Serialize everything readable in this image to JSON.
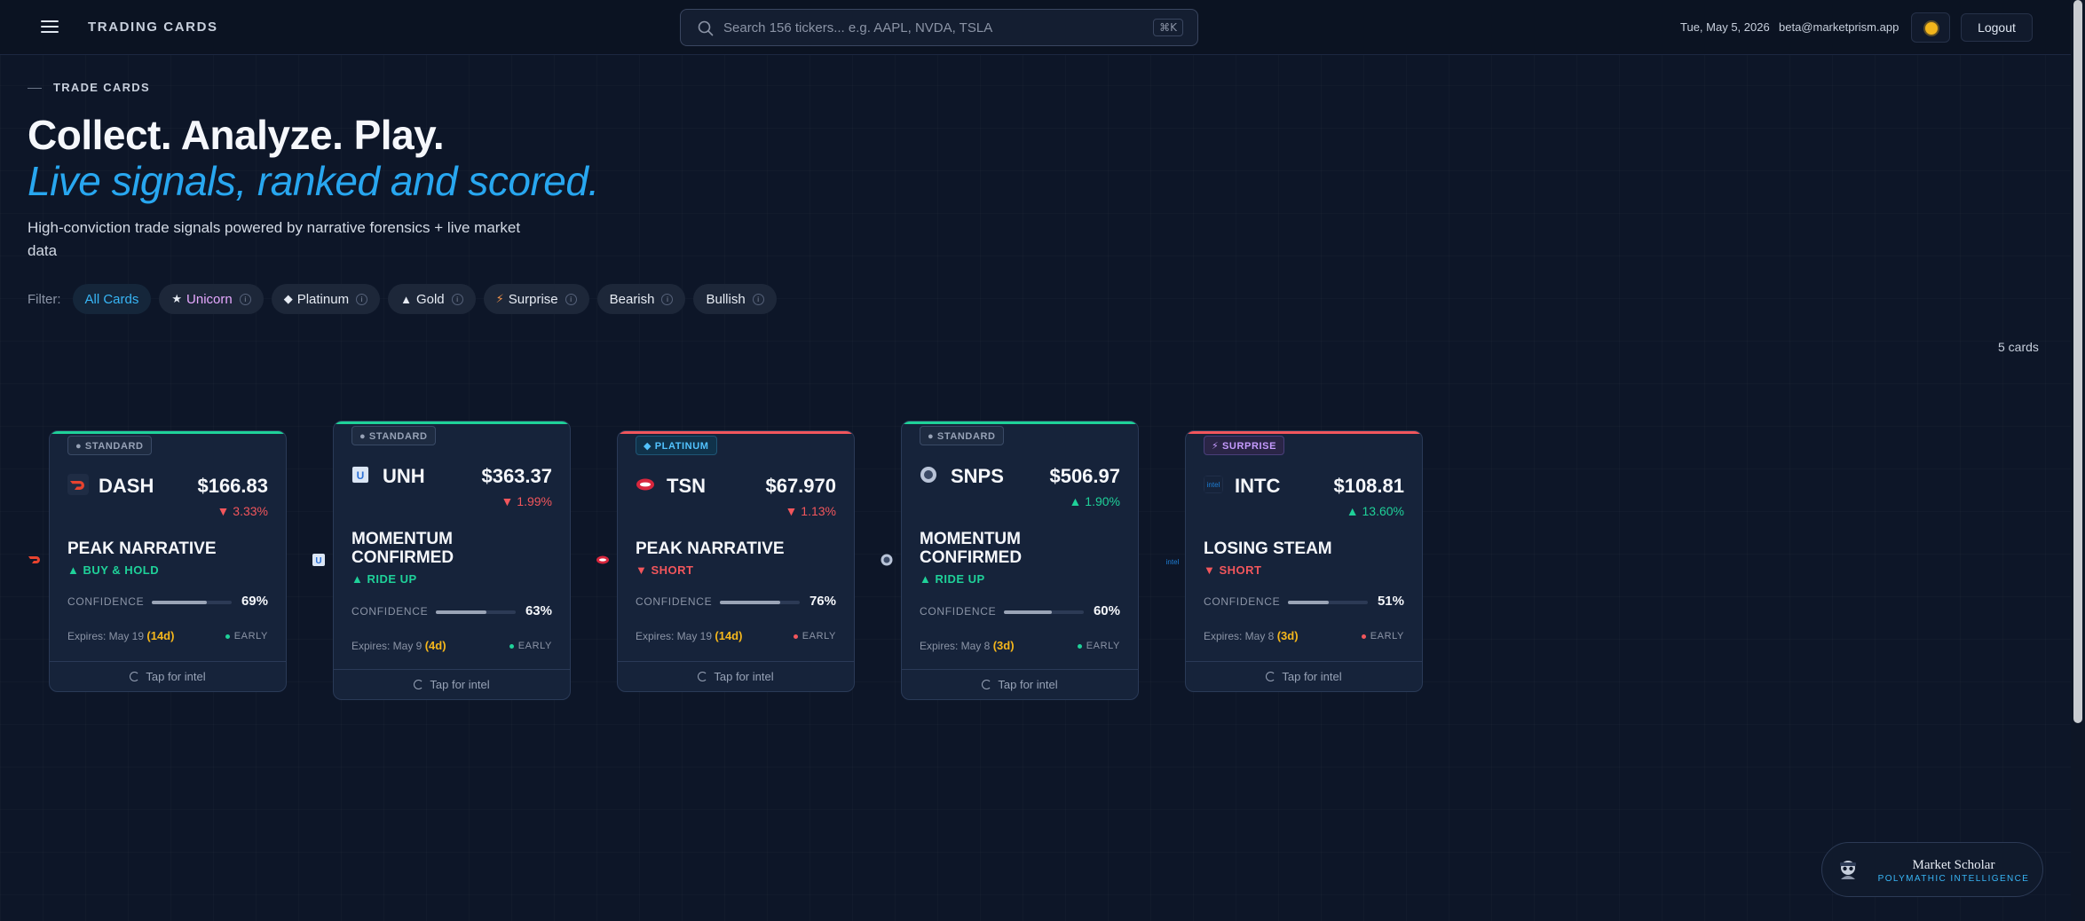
{
  "header": {
    "app_title": "TRADING CARDS",
    "search_placeholder": "Search 156 tickers... e.g. AAPL, NVDA, TSLA",
    "search_shortcut": "⌘K",
    "date": "Tue, May 5, 2026",
    "email": "beta@marketprism.app",
    "logout_label": "Logout"
  },
  "hero": {
    "eyebrow": "TRADE CARDS",
    "title_line1": "Collect. Analyze. Play.",
    "title_line2": "Live signals, ranked and scored.",
    "subtitle": "High-conviction trade signals powered by narrative forensics + live market data"
  },
  "filters": {
    "label": "Filter:",
    "chips": [
      {
        "label": "All Cards",
        "glyph": ""
      },
      {
        "label": "Unicorn",
        "glyph": "★"
      },
      {
        "label": "Platinum",
        "glyph": "◆"
      },
      {
        "label": "Gold",
        "glyph": "▲"
      },
      {
        "label": "Surprise",
        "glyph": "⚡"
      },
      {
        "label": "Bearish",
        "glyph": ""
      },
      {
        "label": "Bullish",
        "glyph": ""
      }
    ],
    "info_glyph": "i"
  },
  "card_count": "5 cards",
  "cards": [
    {
      "tier": "● STANDARD",
      "ticker": "DASH",
      "price": "$166.83",
      "change": "▼ 3.33%",
      "headline": "PEAK NARRATIVE",
      "action": "▲ BUY & HOLD",
      "confidence_label": "CONFIDENCE",
      "confidence": "69%",
      "confidence_fraction": 0.69,
      "expires_prefix": "Expires: May 19",
      "expires_days": "(14d)",
      "stage": "EARLY",
      "tap": "Tap for intel",
      "accent": "#1fd199",
      "stage_color": "#1fd199"
    },
    {
      "tier": "● STANDARD",
      "ticker": "UNH",
      "price": "$363.37",
      "change": "▼ 1.99%",
      "headline": "MOMENTUM CONFIRMED",
      "action": "▲ RIDE UP",
      "confidence_label": "CONFIDENCE",
      "confidence": "63%",
      "confidence_fraction": 0.63,
      "expires_prefix": "Expires: May 9",
      "expires_days": "(4d)",
      "stage": "EARLY",
      "tap": "Tap for intel",
      "accent": "#1fd199",
      "stage_color": "#1fd199"
    },
    {
      "tier": "◆ PLATINUM",
      "ticker": "TSN",
      "price": "$67.970",
      "change": "▼ 1.13%",
      "headline": "PEAK NARRATIVE",
      "action": "▼ SHORT",
      "confidence_label": "CONFIDENCE",
      "confidence": "76%",
      "confidence_fraction": 0.76,
      "expires_prefix": "Expires: May 19",
      "expires_days": "(14d)",
      "stage": "EARLY",
      "tap": "Tap for intel",
      "accent": "#f2565c",
      "stage_color": "#f2565c"
    },
    {
      "tier": "● STANDARD",
      "ticker": "SNPS",
      "price": "$506.97",
      "change": "▲ 1.90%",
      "headline": "MOMENTUM CONFIRMED",
      "action": "▲ RIDE UP",
      "confidence_label": "CONFIDENCE",
      "confidence": "60%",
      "confidence_fraction": 0.6,
      "expires_prefix": "Expires: May 8",
      "expires_days": "(3d)",
      "stage": "EARLY",
      "tap": "Tap for intel",
      "accent": "#1fd199",
      "stage_color": "#1fd199"
    },
    {
      "tier": "⚡ SURPRISE",
      "ticker": "INTC",
      "price": "$108.81",
      "change": "▲ 13.60%",
      "headline": "LOSING STEAM",
      "action": "▼ SHORT",
      "confidence_label": "CONFIDENCE",
      "confidence": "51%",
      "confidence_fraction": 0.51,
      "expires_prefix": "Expires: May 8",
      "expires_days": "(3d)",
      "stage": "EARLY",
      "tap": "Tap for intel",
      "accent": "#f2565c",
      "stage_color": "#f2565c"
    }
  ],
  "card_logos": {
    "dash": "#e8432f",
    "unh": "#2a6fd6",
    "tsn": "#d7263d",
    "snps": "#b9c4d8",
    "intc": "#1e7fd6",
    "intc_text": "intel",
    "unh_text": "U"
  },
  "scholar": {
    "title": "Market Scholar",
    "subtitle": "POLYMATHIC INTELLIGENCE"
  }
}
